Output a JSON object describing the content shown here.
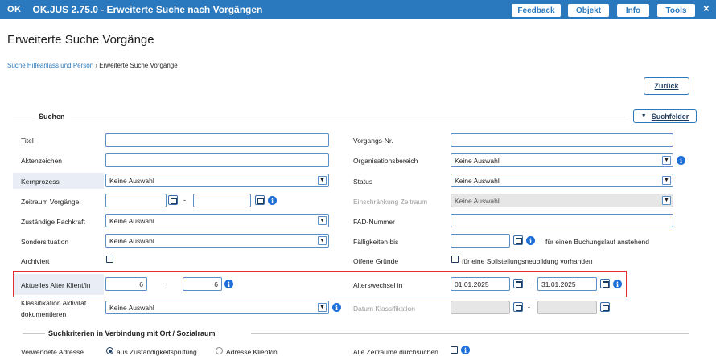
{
  "titlebar": {
    "logo": "OK",
    "title": "OK.JUS 2.75.0 - Erweiterte Suche nach Vorgängen",
    "buttons": [
      "Feedback",
      "Objekt",
      "Info",
      "Tools"
    ],
    "close": "×"
  },
  "page_title": "Erweiterte Suche Vorgänge",
  "breadcrumb": {
    "link": "Suche Hilfeanlass und Person",
    "sep": " › ",
    "current": "Erweiterte Suche Vorgänge"
  },
  "back_button": "Zurück",
  "section_search": "Suchen",
  "fields_button": "Suchfelder",
  "section_location": "Suchkriterien in Verbindung mit Ort / Sozialraum",
  "left": {
    "titel": {
      "label": "Titel",
      "value": ""
    },
    "aktenzeichen": {
      "label": "Aktenzeichen",
      "value": ""
    },
    "kernprozess": {
      "label": "Kernprozess",
      "value": "Keine Auswahl"
    },
    "zeitraum": {
      "label": "Zeitraum Vorgänge",
      "from": "",
      "to": "",
      "dash": "-"
    },
    "fachkraft": {
      "label": "Zuständige Fachkraft",
      "value": "Keine Auswahl"
    },
    "sondersituation": {
      "label": "Sondersituation",
      "value": "Keine Auswahl"
    },
    "archiviert": {
      "label": "Archiviert"
    },
    "alter": {
      "label": "Aktuelles Alter Klient/in",
      "from": "6",
      "to": "6",
      "dash": "-"
    },
    "klassifikation": {
      "label_1": "Klassifikation Aktivität",
      "label_2": "dokumentieren",
      "value": "Keine Auswahl"
    },
    "adresse": {
      "label": "Verwendete Adresse",
      "option_1": "aus Zuständigkeitsprüfung",
      "option_2": "Adresse Klient/in"
    }
  },
  "right": {
    "vorgangsnr": {
      "label": "Vorgangs-Nr.",
      "value": ""
    },
    "organisationsbereich": {
      "label": "Organisationsbereich",
      "value": "Keine Auswahl"
    },
    "status": {
      "label": "Status",
      "value": "Keine Auswahl"
    },
    "einschraenkung": {
      "label": "Einschränkung Zeitraum",
      "value": "Keine Auswahl"
    },
    "fad": {
      "label": "FAD-Nummer",
      "value": ""
    },
    "faelligkeiten": {
      "label": "Fälligkeiten bis",
      "value": "",
      "note": "für einen Buchungslauf anstehend"
    },
    "offene_gruende": {
      "label": "Offene Gründe",
      "checkbox_label": "für eine Sollstellungsneubildung vorhanden"
    },
    "alterswechsel": {
      "label": "Alterswechsel in",
      "from": "01.01.2025",
      "to": "31.01.2025",
      "dash": "-"
    },
    "datum_klassifikation": {
      "label": "Datum Klassifikation",
      "from": "",
      "to": "",
      "dash": "-"
    },
    "alle_zeitraeume": {
      "label": "Alle Zeiträume durchsuchen"
    }
  },
  "icons": {
    "dropdown": "▼",
    "info": "i",
    "tri": "▼"
  }
}
